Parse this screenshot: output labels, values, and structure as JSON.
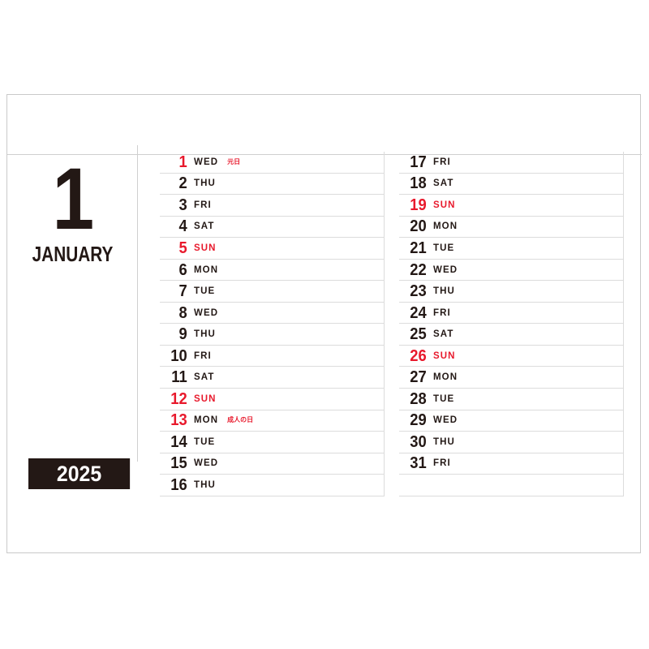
{
  "page": {
    "month_number": "1",
    "month_name": "JANUARY",
    "year": "2025"
  },
  "columns": [
    {
      "name": "days-1-16",
      "days": [
        {
          "num": "1",
          "weekday": "WED",
          "note": "元日",
          "red_num": true,
          "red_name": false
        },
        {
          "num": "2",
          "weekday": "THU",
          "note": "",
          "red_num": false,
          "red_name": false
        },
        {
          "num": "3",
          "weekday": "FRI",
          "note": "",
          "red_num": false,
          "red_name": false
        },
        {
          "num": "4",
          "weekday": "SAT",
          "note": "",
          "red_num": false,
          "red_name": false
        },
        {
          "num": "5",
          "weekday": "SUN",
          "note": "",
          "red_num": true,
          "red_name": true
        },
        {
          "num": "6",
          "weekday": "MON",
          "note": "",
          "red_num": false,
          "red_name": false
        },
        {
          "num": "7",
          "weekday": "TUE",
          "note": "",
          "red_num": false,
          "red_name": false
        },
        {
          "num": "8",
          "weekday": "WED",
          "note": "",
          "red_num": false,
          "red_name": false
        },
        {
          "num": "9",
          "weekday": "THU",
          "note": "",
          "red_num": false,
          "red_name": false
        },
        {
          "num": "10",
          "weekday": "FRI",
          "note": "",
          "red_num": false,
          "red_name": false
        },
        {
          "num": "11",
          "weekday": "SAT",
          "note": "",
          "red_num": false,
          "red_name": false
        },
        {
          "num": "12",
          "weekday": "SUN",
          "note": "",
          "red_num": true,
          "red_name": true
        },
        {
          "num": "13",
          "weekday": "MON",
          "note": "成人の日",
          "red_num": true,
          "red_name": false
        },
        {
          "num": "14",
          "weekday": "TUE",
          "note": "",
          "red_num": false,
          "red_name": false
        },
        {
          "num": "15",
          "weekday": "WED",
          "note": "",
          "red_num": false,
          "red_name": false
        },
        {
          "num": "16",
          "weekday": "THU",
          "note": "",
          "red_num": false,
          "red_name": false
        }
      ]
    },
    {
      "name": "days-17-31",
      "days": [
        {
          "num": "17",
          "weekday": "FRI",
          "note": "",
          "red_num": false,
          "red_name": false
        },
        {
          "num": "18",
          "weekday": "SAT",
          "note": "",
          "red_num": false,
          "red_name": false
        },
        {
          "num": "19",
          "weekday": "SUN",
          "note": "",
          "red_num": true,
          "red_name": true
        },
        {
          "num": "20",
          "weekday": "MON",
          "note": "",
          "red_num": false,
          "red_name": false
        },
        {
          "num": "21",
          "weekday": "TUE",
          "note": "",
          "red_num": false,
          "red_name": false
        },
        {
          "num": "22",
          "weekday": "WED",
          "note": "",
          "red_num": false,
          "red_name": false
        },
        {
          "num": "23",
          "weekday": "THU",
          "note": "",
          "red_num": false,
          "red_name": false
        },
        {
          "num": "24",
          "weekday": "FRI",
          "note": "",
          "red_num": false,
          "red_name": false
        },
        {
          "num": "25",
          "weekday": "SAT",
          "note": "",
          "red_num": false,
          "red_name": false
        },
        {
          "num": "26",
          "weekday": "SUN",
          "note": "",
          "red_num": true,
          "red_name": true
        },
        {
          "num": "27",
          "weekday": "MON",
          "note": "",
          "red_num": false,
          "red_name": false
        },
        {
          "num": "28",
          "weekday": "TUE",
          "note": "",
          "red_num": false,
          "red_name": false
        },
        {
          "num": "29",
          "weekday": "WED",
          "note": "",
          "red_num": false,
          "red_name": false
        },
        {
          "num": "30",
          "weekday": "THU",
          "note": "",
          "red_num": false,
          "red_name": false
        },
        {
          "num": "31",
          "weekday": "FRI",
          "note": "",
          "red_num": false,
          "red_name": false
        },
        {
          "num": "",
          "weekday": "",
          "note": "",
          "red_num": false,
          "red_name": false
        }
      ]
    }
  ],
  "colors": {
    "ink": "#231815",
    "red": "#e8192c",
    "rule": "#dcdcdc",
    "frame": "#c9c9c9"
  }
}
